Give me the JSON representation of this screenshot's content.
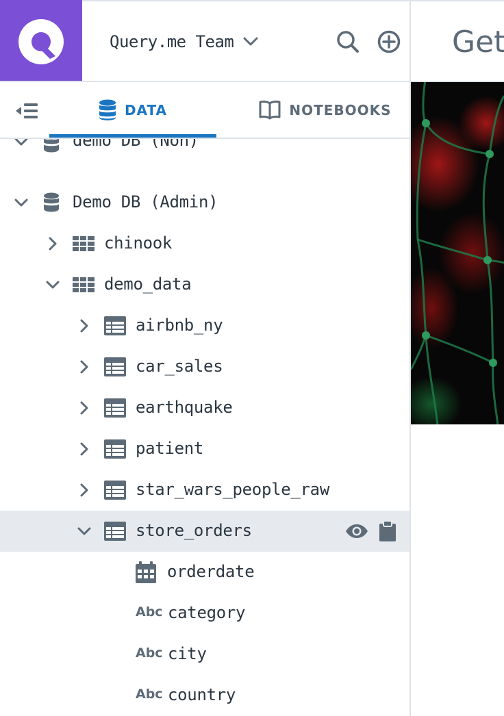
{
  "header": {
    "team_name": "Query.me Team",
    "right_title": "Get"
  },
  "tabs": {
    "data_label": "DATA",
    "notebooks_label": "NOTEBOOKS"
  },
  "tree": {
    "partial_row_label": "demo DB (Non)",
    "db_label": "Demo DB (Admin)",
    "schema_chinook": "chinook",
    "schema_demo_data": "demo_data",
    "tables": [
      "airbnb_ny",
      "car_sales",
      "earthquake",
      "patient",
      "star_wars_people_raw",
      "store_orders"
    ],
    "columns": [
      {
        "type": "date",
        "name": "orderdate"
      },
      {
        "type": "Abc",
        "name": "category"
      },
      {
        "type": "Abc",
        "name": "city"
      },
      {
        "type": "Abc",
        "name": "country"
      }
    ]
  },
  "colors": {
    "brand": "#7b4fd6",
    "accent": "#1b76c2",
    "icon": "#5d6b78",
    "selected_row": "#e6eaee"
  },
  "icons": {
    "logo": "query-me-logo-icon",
    "search": "search-icon",
    "add": "plus-circle-icon",
    "collapse": "collapse-sidebar-icon",
    "database": "database-icon",
    "schema": "schema-grid-icon",
    "table": "table-icon",
    "preview": "eye-icon",
    "copy": "clipboard-icon",
    "date": "calendar-icon"
  }
}
